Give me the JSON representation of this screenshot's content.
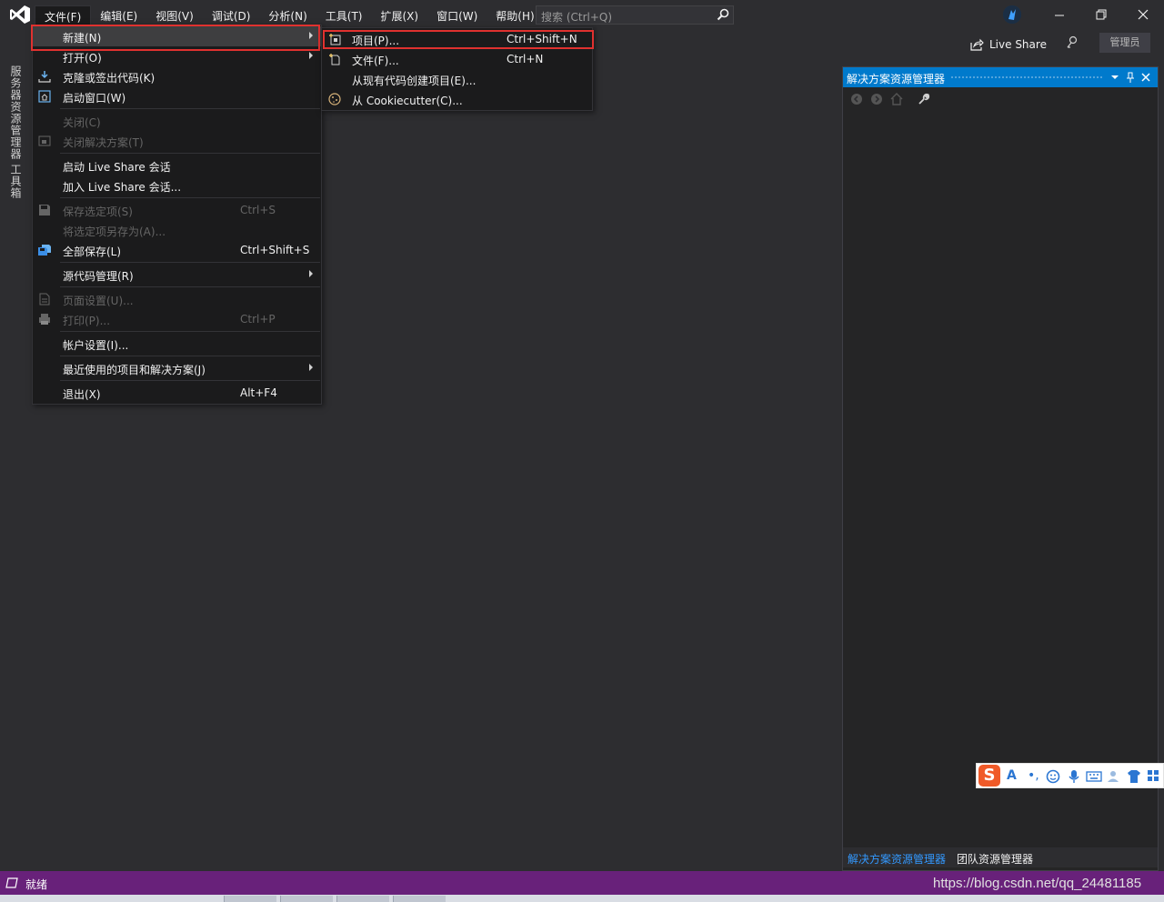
{
  "menubar": {
    "items": [
      "文件(F)",
      "编辑(E)",
      "视图(V)",
      "调试(D)",
      "分析(N)",
      "工具(T)",
      "扩展(X)",
      "窗口(W)",
      "帮助(H)"
    ],
    "search_placeholder": "搜索 (Ctrl+Q)"
  },
  "toolbar": {
    "live_share": "Live Share",
    "admin": "管理员"
  },
  "left_tabs": [
    "服务器资源管理器",
    "工具箱"
  ],
  "file_menu": {
    "new": "新建(N)",
    "open": "打开(O)",
    "clone": "克隆或签出代码(K)",
    "start_window": "启动窗口(W)",
    "close": "关闭(C)",
    "close_solution": "关闭解决方案(T)",
    "start_liveshare": "启动 Live Share 会话",
    "join_liveshare": "加入 Live Share 会话...",
    "save_selected": "保存选定项(S)",
    "save_selected_sc": "Ctrl+S",
    "save_selected_as": "将选定项另存为(A)...",
    "save_all": "全部保存(L)",
    "save_all_sc": "Ctrl+Shift+S",
    "source_control": "源代码管理(R)",
    "page_setup": "页面设置(U)...",
    "print": "打印(P)...",
    "print_sc": "Ctrl+P",
    "account_settings": "帐户设置(I)...",
    "recent": "最近使用的项目和解决方案(J)",
    "exit": "退出(X)",
    "exit_sc": "Alt+F4"
  },
  "new_submenu": {
    "project": "项目(P)...",
    "project_sc": "Ctrl+Shift+N",
    "file": "文件(F)...",
    "file_sc": "Ctrl+N",
    "from_existing": "从现有代码创建项目(E)...",
    "from_cookiecutter": "从 Cookiecutter(C)..."
  },
  "solution_explorer": {
    "title": "解决方案资源管理器",
    "tabs": [
      "解决方案资源管理器",
      "团队资源管理器"
    ]
  },
  "statusbar": {
    "text": "就绪",
    "watermark": "https://blog.csdn.net/qq_24481185"
  },
  "colors": {
    "accent": "#007acc",
    "status": "#68217a",
    "highlight_box": "#e0312f"
  }
}
